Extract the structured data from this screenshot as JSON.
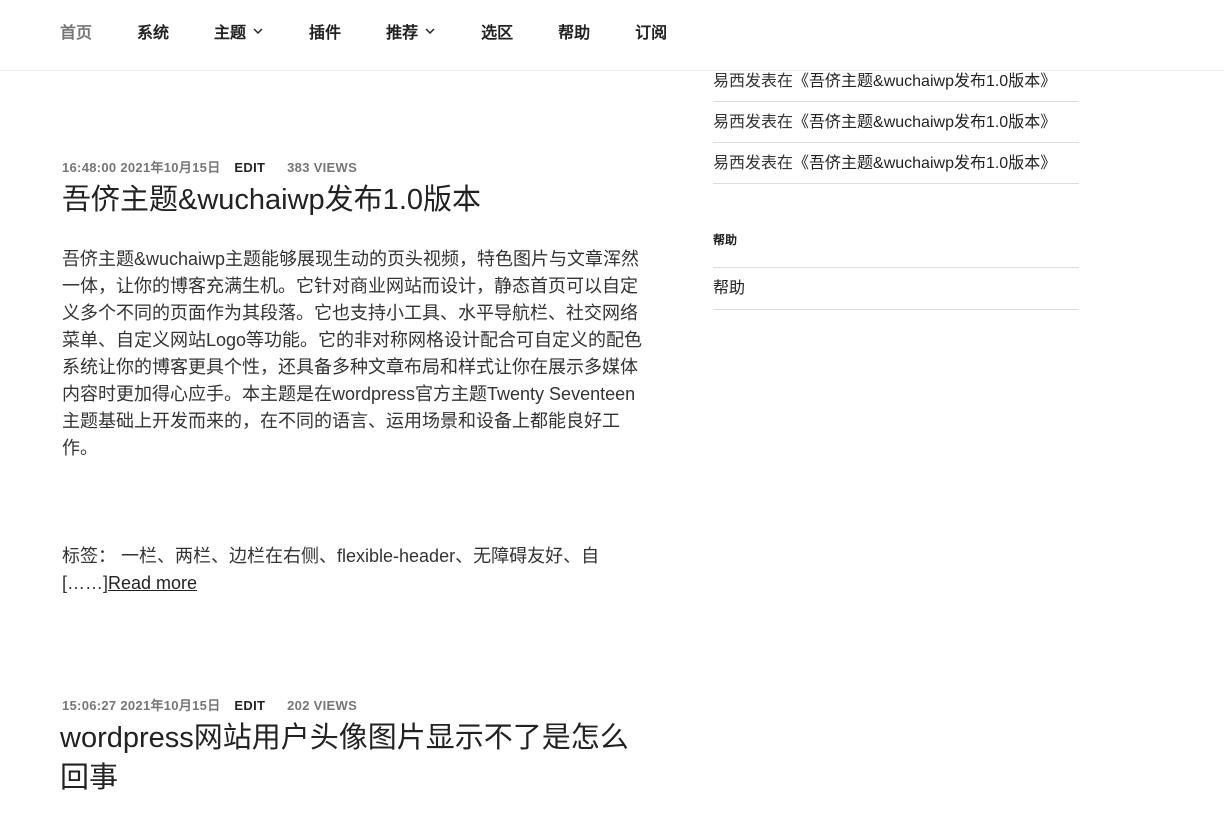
{
  "nav": {
    "items": [
      {
        "label": "首页",
        "current": true,
        "has_dropdown": false
      },
      {
        "label": "系统",
        "current": false,
        "has_dropdown": false
      },
      {
        "label": "主题",
        "current": false,
        "has_dropdown": true
      },
      {
        "label": "插件",
        "current": false,
        "has_dropdown": false
      },
      {
        "label": "推荐",
        "current": false,
        "has_dropdown": true
      },
      {
        "label": "选区",
        "current": false,
        "has_dropdown": false
      },
      {
        "label": "帮助",
        "current": false,
        "has_dropdown": false
      },
      {
        "label": "订阅",
        "current": false,
        "has_dropdown": false
      }
    ]
  },
  "posts": [
    {
      "datetime": "16:48:00 2021年10月15日",
      "edit_label": "EDIT",
      "views": "383 VIEWS",
      "title": "吾侪主题&wuchaiwp发布1.0版本",
      "excerpt": "吾侪主题&wuchaiwp主题能够展现生动的页头视频，特色图片与文章浑然一体，让你的博客充满生机。它针对商业网站而设计，静态首页可以自定义多个不同的页面作为其段落。它也支持小工具、水平导航栏、社交网络菜单、自定义网站Logo等功能。它的非对称网格设计配合可自定义的配色系统让你的博客更具个性，还具备多种文章布局和样式让你在展示多媒体内容时更加得心应手。本主题是在wordpress官方主题Twenty Seventeen主题基础上开发而来的，在不同的语言、运用场景和设备上都能良好工作。",
      "tags": "标签： 一栏、两栏、边栏在右侧、flexible-header、无障碍友好、自[……]",
      "read_more": "Read more"
    },
    {
      "datetime": "15:06:27 2021年10月15日",
      "edit_label": "EDIT",
      "views": "202 VIEWS",
      "title": "wordpress网站用户头像图片显示不了是怎么回事"
    }
  ],
  "sidebar": {
    "recent_comments": [
      {
        "author": "易西",
        "connector": "发表在",
        "post": "《吾侪主题&wuchaiwp发布1.0版本》"
      },
      {
        "author": "易西",
        "connector": "发表在",
        "post": "《吾侪主题&wuchaiwp发布1.0版本》"
      },
      {
        "author": "易西",
        "connector": "发表在",
        "post": "《吾侪主题&wuchaiwp发布1.0版本》"
      }
    ],
    "help_widget": {
      "title": "帮助",
      "items": [
        "帮助"
      ]
    }
  },
  "colors": {
    "text": "#222222",
    "muted": "#767676",
    "border": "#dddddd",
    "background": "#ffffff"
  }
}
